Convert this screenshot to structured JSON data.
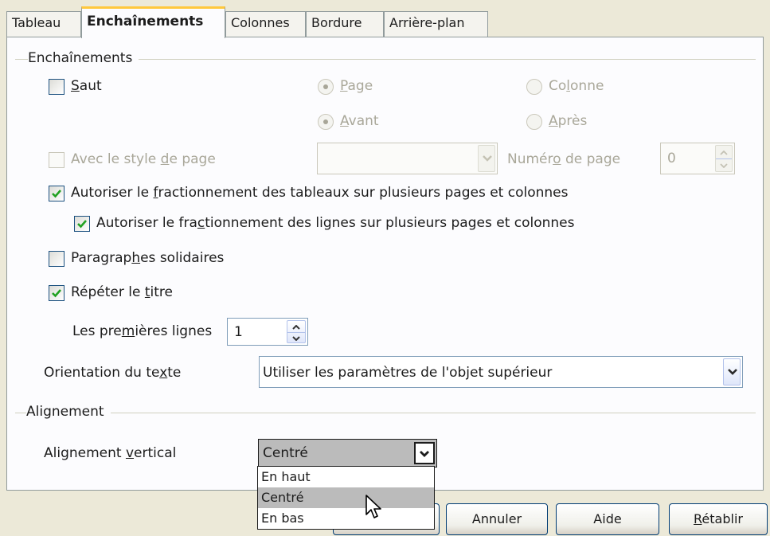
{
  "tabs": [
    {
      "label": "Tableau",
      "active": false
    },
    {
      "label": "Enchaînements",
      "active": true
    },
    {
      "label": "Colonnes",
      "active": false
    },
    {
      "label": "Bordure",
      "active": false
    },
    {
      "label": "Arrière-plan",
      "active": false
    }
  ],
  "enchainements": {
    "section_title": "Enchaînements",
    "saut": {
      "label": "Saut",
      "checked": false
    },
    "radio_page": {
      "label": "Page",
      "selected": true,
      "enabled": false
    },
    "radio_colonne": {
      "label": "Colonne",
      "selected": false,
      "enabled": false
    },
    "radio_avant": {
      "label": "Avant",
      "selected": true,
      "enabled": false
    },
    "radio_apres": {
      "label": "Après",
      "selected": false,
      "enabled": false
    },
    "avec_style": {
      "label": "Avec le style de page",
      "checked": false,
      "enabled": false
    },
    "page_style_value": "",
    "numero_page_label": "Numéro de page",
    "numero_page_value": "0",
    "autoriser_tableaux": {
      "label": "Autoriser le fractionnement des tableaux sur plusieurs pages et colonnes",
      "checked": true
    },
    "autoriser_lignes": {
      "label": "Autoriser le fractionnement des lignes sur plusieurs pages et colonnes",
      "checked": true
    },
    "paragraphes_solidaires": {
      "label": "Paragraphes solidaires",
      "checked": false
    },
    "repeter_titre": {
      "label": "Répéter le titre",
      "checked": true
    },
    "premieres_lignes_label": "Les premières lignes",
    "premieres_lignes_value": "1",
    "orientation_label": "Orientation du texte",
    "orientation_value": "Utiliser les paramètres de l'objet supérieur"
  },
  "alignement": {
    "section_title": "Alignement",
    "vertical_label": "Alignement vertical",
    "vertical_value": "Centré",
    "options": [
      "En haut",
      "Centré",
      "En bas"
    ],
    "highlighted_option": "Centré"
  },
  "buttons": {
    "annuler": "Annuler",
    "aide": "Aide",
    "retablir": "Rétablir"
  }
}
